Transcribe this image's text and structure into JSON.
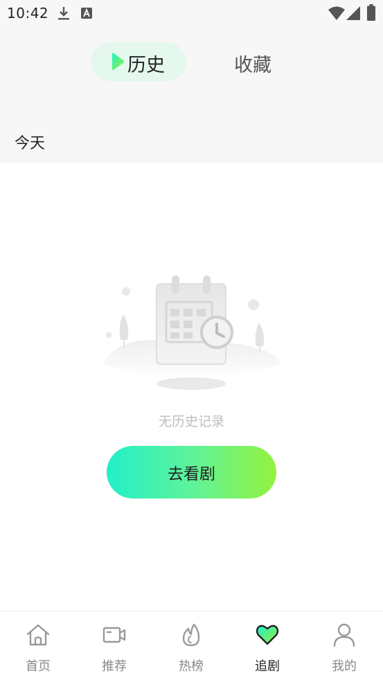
{
  "status_bar": {
    "time": "10:42",
    "icons": [
      "download-icon",
      "keyboard-a-icon",
      "wifi-icon",
      "signal-icon",
      "battery-icon"
    ]
  },
  "tabs": {
    "history": "历史",
    "favorites": "收藏",
    "active": "history"
  },
  "section": {
    "today": "今天"
  },
  "empty_state": {
    "message": "无历史记录",
    "button": "去看剧",
    "illustration": "calendar-clock-icon"
  },
  "bottom_nav": {
    "items": [
      {
        "label": "首页",
        "icon": "home-icon"
      },
      {
        "label": "推荐",
        "icon": "video-icon"
      },
      {
        "label": "热榜",
        "icon": "flame-icon"
      },
      {
        "label": "追剧",
        "icon": "heart-icon"
      },
      {
        "label": "我的",
        "icon": "user-icon"
      }
    ],
    "active_index": 3
  },
  "colors": {
    "accent_start": "#22f0c8",
    "accent_end": "#94f23e",
    "tab_active_bg": "#e4f8ee",
    "top_bg": "#f7f7f7"
  }
}
